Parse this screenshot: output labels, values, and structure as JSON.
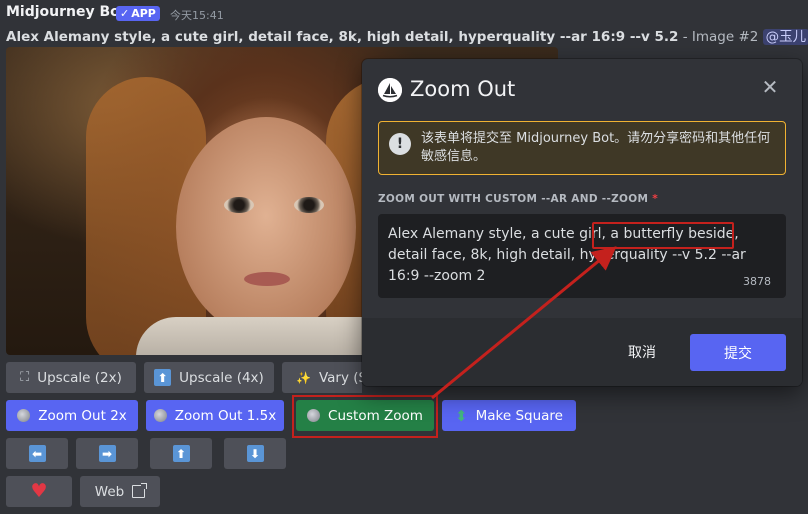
{
  "message": {
    "bot_name": "Midjourney Bot",
    "app_badge": "APP",
    "app_badge_check": "✓",
    "timestamp": "今天15:41",
    "prompt": "Alex Alemany style, a cute girl, detail face, 8k, high detail, hyperquality --ar 16:9 --v 5.2",
    "prompt_suffix": " - Image #2 ",
    "mention": "@玉儿"
  },
  "buttons": {
    "upscale_2x": "Upscale (2x)",
    "upscale_4x": "Upscale (4x)",
    "vary": "Vary (S",
    "zoom_out_2x": "Zoom Out 2x",
    "zoom_out_1_5x": "Zoom Out 1.5x",
    "custom_zoom": "Custom Zoom",
    "make_square": "Make Square",
    "pan_left": "⬅",
    "pan_right": "➡",
    "pan_up": "⬆",
    "pan_down": "⬇",
    "web": "Web"
  },
  "icons": {
    "upscale": "⛶",
    "close": "✕",
    "warning": "!",
    "vary": "✨",
    "make_square": "⬍",
    "heart": "♥"
  },
  "modal": {
    "title": "Zoom Out",
    "notice": "该表单将提交至 Midjourney Bot。请勿分享密码和其他任何敏感信息。",
    "field_label": "ZOOM OUT WITH CUSTOM --AR AND --ZOOM",
    "required": "*",
    "textarea_value": "Alex Alemany style, a cute girl, a butterfly beside, detail face, 8k, high detail, hyperquality --v 5.2 --ar 16:9 --zoom 2",
    "char_count": "3878",
    "cancel": "取消",
    "submit": "提交"
  },
  "colors": {
    "background": "#313338",
    "blurple": "#5865f2",
    "green": "#248046",
    "annotation_red": "#c4211d"
  }
}
